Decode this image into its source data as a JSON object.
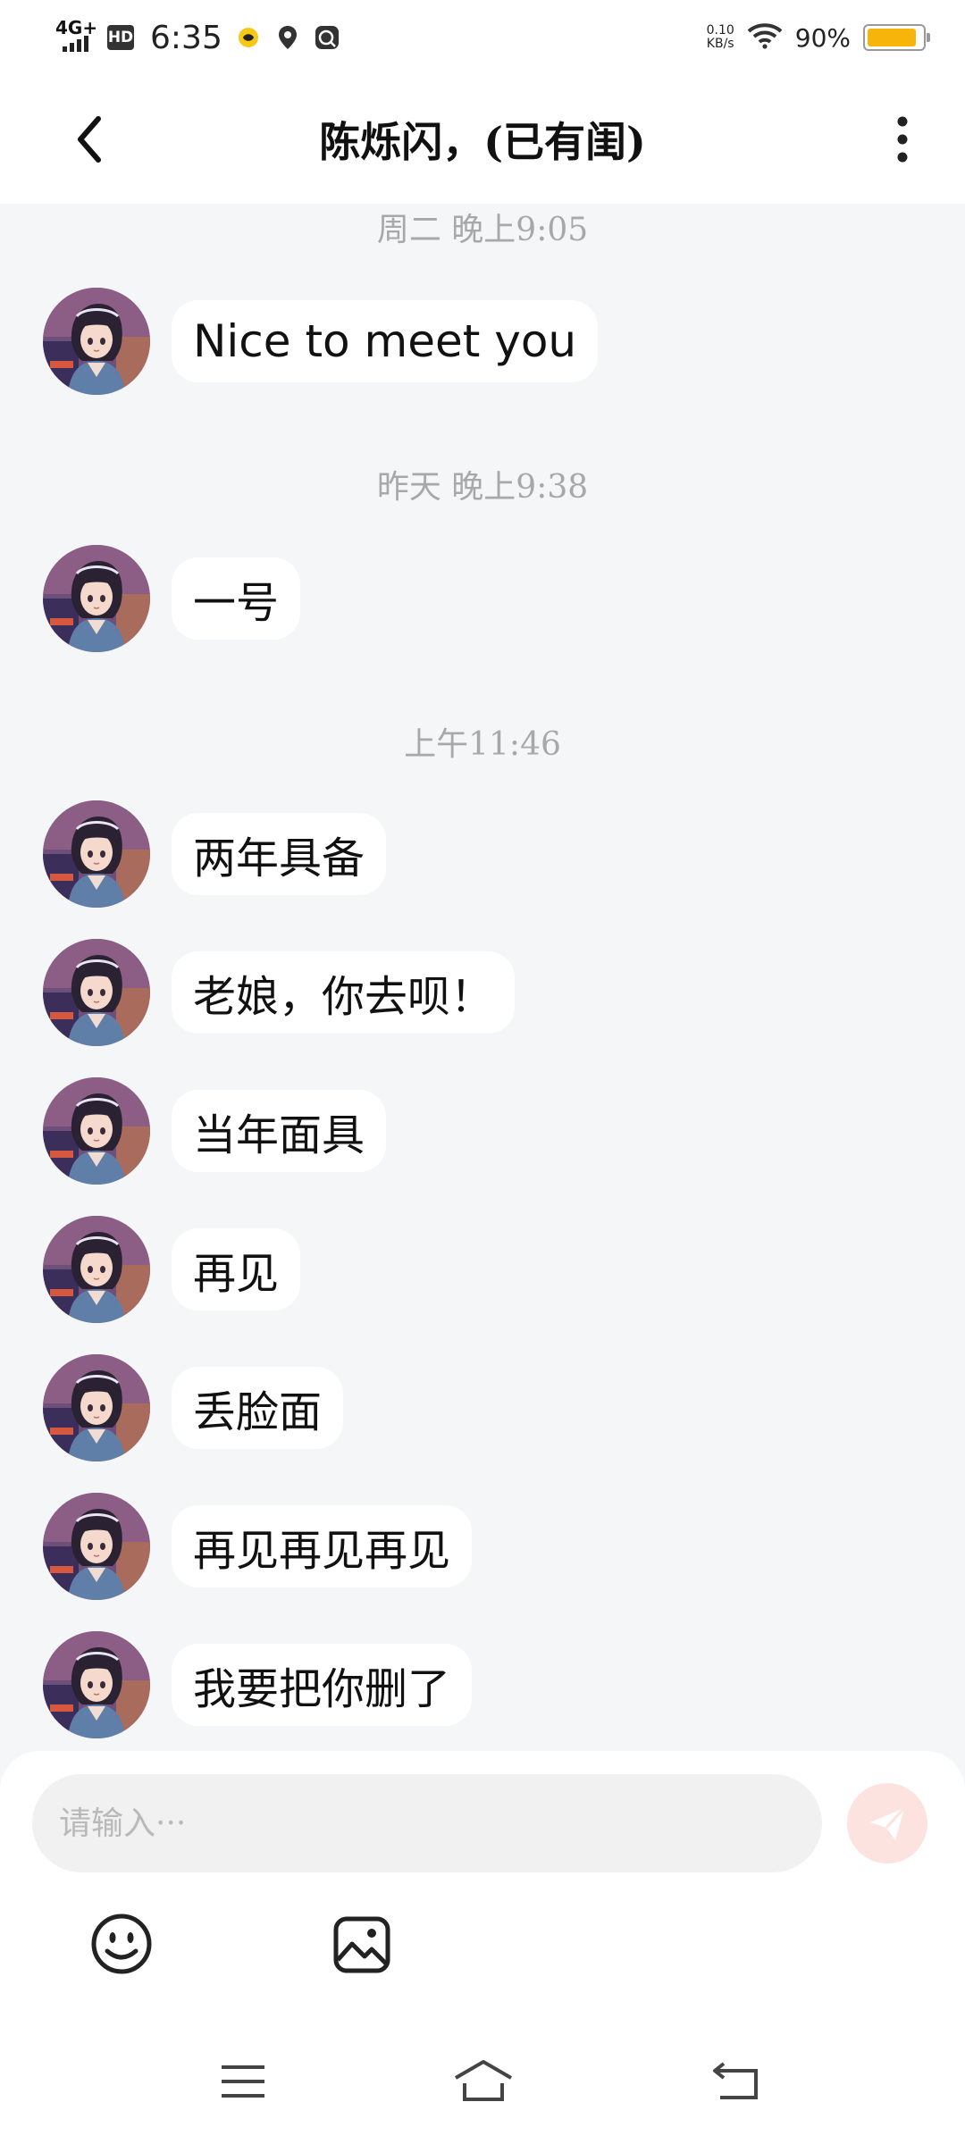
{
  "status_bar": {
    "network": "4G+",
    "hd": "HD",
    "time": "6:35",
    "speed_value": "0.10",
    "speed_unit": "KB/s",
    "battery_percent": "90%",
    "battery_level": 0.9,
    "icons": [
      "signal-icon",
      "hd-icon",
      "qq-notification-icon",
      "location-icon",
      "baidu-icon",
      "wifi-icon",
      "battery-icon"
    ]
  },
  "header": {
    "title": "陈烁闪，(已有闺)",
    "back_icon": "chevron-left-icon",
    "more_icon": "more-vertical-icon"
  },
  "chat": {
    "timestamps": [
      "周二 晚上9:05",
      "昨天 晚上9:38",
      "上午11:46"
    ],
    "messages": [
      "Nice to meet you",
      "一号",
      "两年具备",
      "老娘，你去呗！",
      "当年面具",
      "再见",
      "丢脸面",
      "再见再见再见",
      "我要把你删了"
    ]
  },
  "composer": {
    "placeholder": "请输入···",
    "input_value": "",
    "send_icon": "send-icon",
    "emoji_icon": "emoji-icon",
    "image_icon": "image-icon"
  },
  "nav": {
    "icons": [
      "menu-icon",
      "home-icon",
      "back-icon"
    ]
  },
  "colors": {
    "background": "#f5f6f8",
    "bubble": "#ffffff",
    "send_button": "#fde3df",
    "battery": "#f7b40a"
  }
}
